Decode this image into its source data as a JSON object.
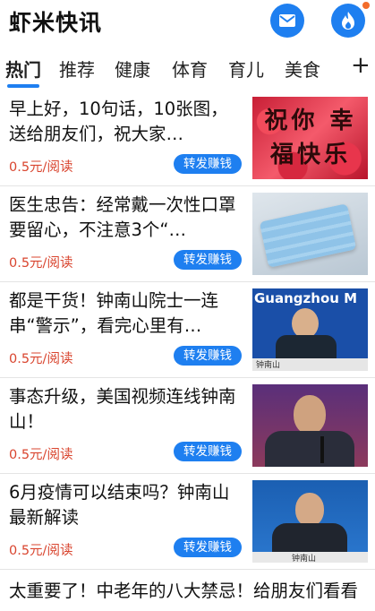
{
  "header": {
    "title": "虾米快讯",
    "message_icon": "envelope-icon",
    "hot_icon": "flame-icon"
  },
  "tabs": [
    "热门",
    "推荐",
    "健康",
    "体育",
    "育儿",
    "美食"
  ],
  "add_tab": "+",
  "articles": [
    {
      "title": "早上好，10句话，10张图，送给朋友们，祝大家…",
      "price": "0.5元/阅读",
      "share": "转发赚钱",
      "image_text": "祝你 幸福快乐"
    },
    {
      "title": "医生忠告：经常戴一次性口罩要留心，不注意3个“…",
      "price": "0.5元/阅读",
      "share": "转发赚钱"
    },
    {
      "title": "都是干货！钟南山院士一连串“警示”，看完心里有…",
      "price": "0.5元/阅读",
      "share": "转发赚钱",
      "image_text": "Guangzhou M",
      "caption": "钟南山"
    },
    {
      "title": "事态升级，美国视频连线钟南山！",
      "price": "0.5元/阅读",
      "share": "转发赚钱"
    },
    {
      "title": "6月疫情可以结束吗？钟南山最新解读",
      "price": "0.5元/阅读",
      "share": "转发赚钱",
      "caption": "钟南山"
    }
  ],
  "last_article": {
    "title": "太重要了！中老年的八大禁忌！给朋友们看看"
  },
  "colors": {
    "accent": "#1e7ff0",
    "price": "#d9452f"
  }
}
